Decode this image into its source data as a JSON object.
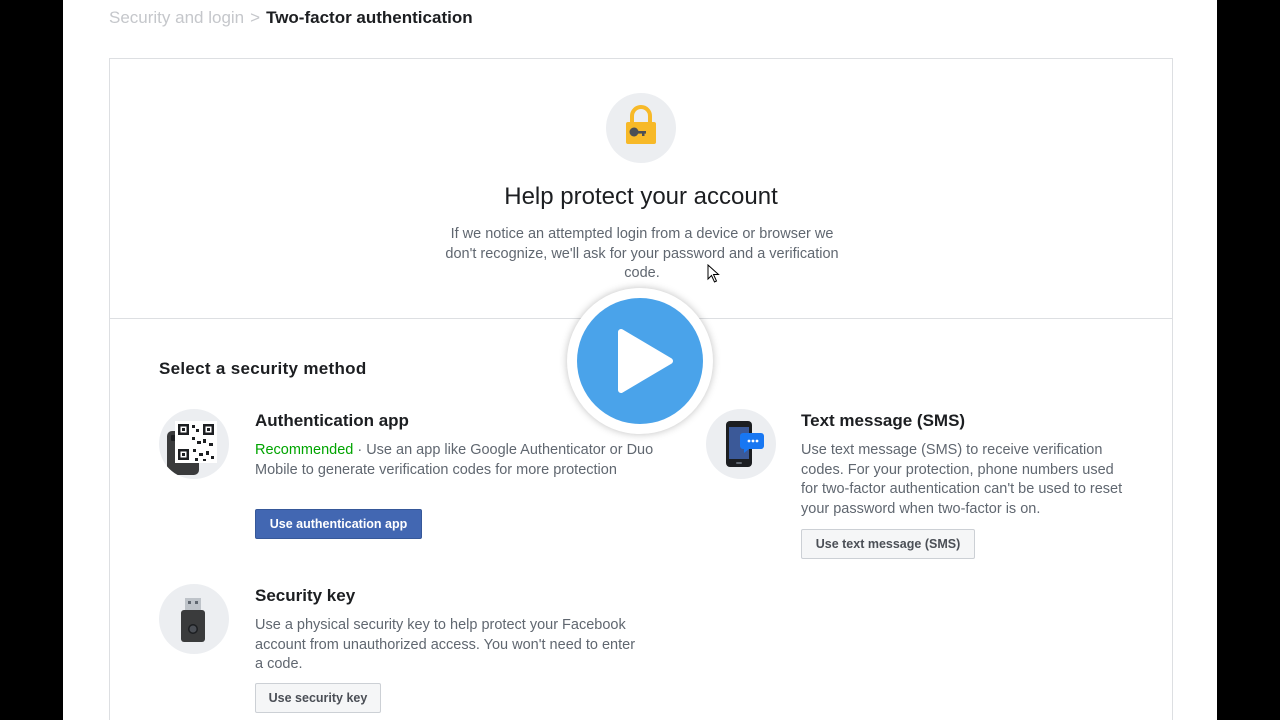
{
  "breadcrumb": {
    "parent": "Security and login",
    "separator": ">",
    "current": "Two-factor authentication"
  },
  "hero": {
    "icon": "lock-key-icon",
    "title": "Help protect your account",
    "description": "If we notice an attempted login from a device or browser we don't recognize, we'll ask for your password and a verification code."
  },
  "section": {
    "title": "Select a security method"
  },
  "methods": {
    "app": {
      "icon": "qr-code-phone-icon",
      "title": "Authentication app",
      "recommended": "Recommended",
      "description": " · Use an app like Google Authenticator or Duo Mobile to generate verification codes for more protection",
      "button": "Use authentication app"
    },
    "sms": {
      "icon": "phone-message-icon",
      "title": "Text message (SMS)",
      "description": "Use text message (SMS) to receive verification codes. For your protection, phone numbers used for two-factor authentication can't be used to reset your password when two-factor is on.",
      "button": "Use text message (SMS)"
    },
    "key": {
      "icon": "usb-security-key-icon",
      "title": "Security key",
      "description": "Use a physical security key to help protect your Facebook account from unauthorized access. You won't need to enter a code.",
      "button": "Use security key"
    }
  },
  "overlay": {
    "icon": "play-icon"
  },
  "colors": {
    "primary_button": "#4267b2",
    "recommended": "#00a400",
    "play": "#4aa3ea",
    "lock": "#f7b928"
  }
}
